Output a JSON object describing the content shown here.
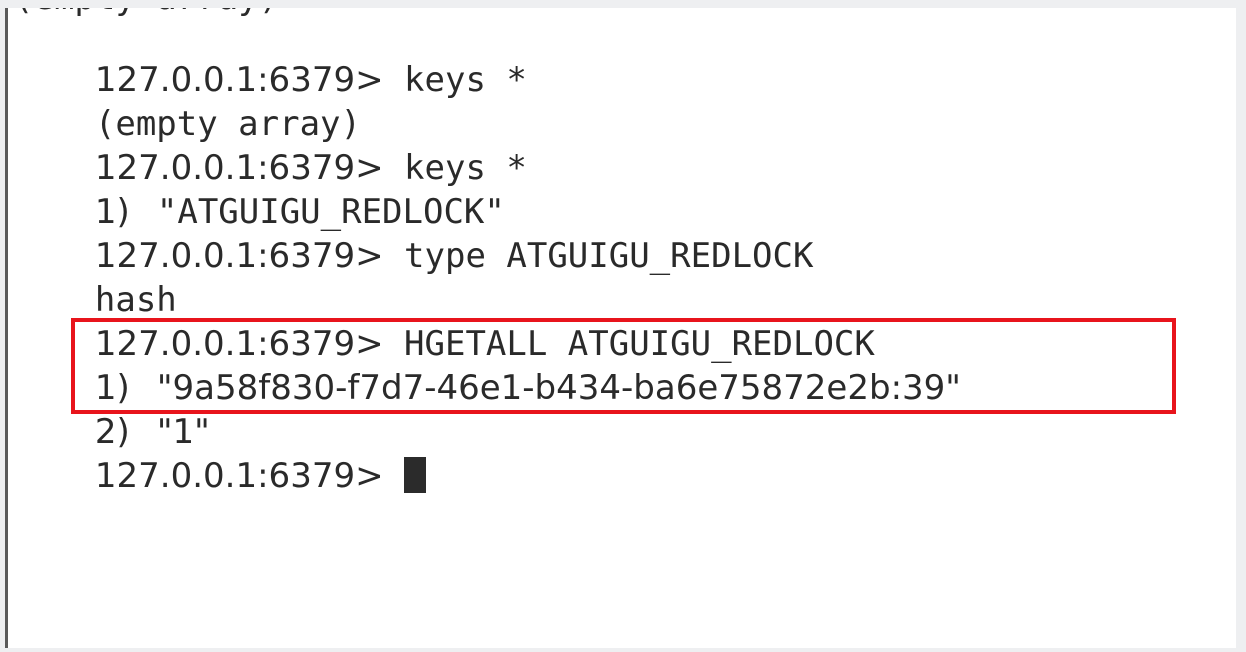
{
  "terminal": {
    "top_fragment": "(empty array)",
    "lines": [
      {
        "prompt": "127.0.0.1:6379>",
        "command": " keys *"
      },
      {
        "output": "(empty array)"
      },
      {
        "prompt": "127.0.0.1:6379>",
        "command": " keys *"
      },
      {
        "index": "1)",
        "value": "\"ATGUIGU_REDLOCK\""
      },
      {
        "prompt": "127.0.0.1:6379>",
        "command": " type ATGUIGU_REDLOCK"
      },
      {
        "output": "hash"
      },
      {
        "prompt": "127.0.0.1:6379>",
        "command": " HGETALL ATGUIGU_REDLOCK"
      },
      {
        "index": "1)",
        "value": "\"9a58f830-f7d7-46e1-b434-ba6e75872e2b:39\""
      },
      {
        "index": "2)",
        "value": "\"1\""
      },
      {
        "prompt": "127.0.0.1:6379>",
        "command": " "
      }
    ]
  },
  "highlight": {
    "color": "#e8141c"
  }
}
